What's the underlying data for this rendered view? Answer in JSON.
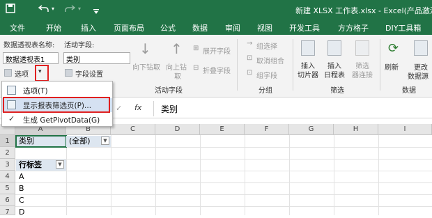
{
  "titlebar": {
    "save_icon": "save-icon",
    "undo_icon": "undo-icon",
    "redo_icon": "redo-icon",
    "title": "新建 XLSX 工作表.xlsx - Excel(产品激活失"
  },
  "tabs": [
    "文件",
    "开始",
    "插入",
    "页面布局",
    "公式",
    "数据",
    "审阅",
    "视图",
    "开发工具",
    "方方格子",
    "DIY工具箱"
  ],
  "ribbon": {
    "pivot_name_label": "数据透视表名称:",
    "pivot_name_value": "数据透视表1",
    "options_button": "选项",
    "active_field_label": "活动字段:",
    "active_field_value": "类别",
    "field_settings": "字段设置",
    "drill_down": "向下钻取",
    "drill_up_1": "向上钻",
    "drill_up_2": "取",
    "expand_field": "展开字段",
    "collapse_field": "折叠字段",
    "group_active_field": "活动字段",
    "group_selection": "组选择",
    "ungroup": "取消组合",
    "group_field": "组字段",
    "group_group": "分组",
    "insert_slicer_1": "插入",
    "insert_slicer_2": "切片器",
    "insert_timeline_1": "插入",
    "insert_timeline_2": "日程表",
    "filter_conn_1": "筛选",
    "filter_conn_2": "器连接",
    "group_filter": "筛选",
    "refresh": "刷新",
    "change_source_1": "更改",
    "change_source_2": "数据源",
    "group_data": "数据"
  },
  "menu": {
    "items": [
      {
        "label": "选项(T)",
        "icon": "options-icon"
      },
      {
        "label": "显示报表筛选页(P)...",
        "icon": "report-filter-pages-icon"
      },
      {
        "label": "生成 GetPivotData(G)",
        "icon": "checkmark-icon"
      }
    ]
  },
  "formula_bar": {
    "fx": "fx",
    "value": "类别"
  },
  "sheet": {
    "columns": [
      "A",
      "B",
      "C",
      "D",
      "E",
      "F",
      "G",
      "H",
      "I"
    ],
    "rows": [
      "1",
      "2",
      "3",
      "4",
      "5",
      "6",
      "7"
    ],
    "a1": "类别",
    "b1": "(全部)",
    "a3": "行标签",
    "a4": "A",
    "a5": "B",
    "a6": "C",
    "a7": "D"
  },
  "colors": {
    "excel_green": "#217346",
    "highlight_red": "#e02020",
    "menu_hover": "#d5e1f2"
  }
}
